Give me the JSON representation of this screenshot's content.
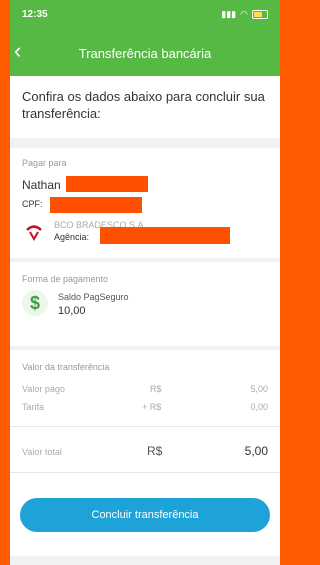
{
  "status_bar": {
    "time": "12:35",
    "icons": [
      "signal-icon",
      "wifi-icon",
      "battery-icon"
    ]
  },
  "header": {
    "title": "Transferência bancária"
  },
  "intro": {
    "text": "Confira os dados abaixo para concluir sua transferência:"
  },
  "payee": {
    "label": "Pagar para",
    "name": "Nathan",
    "cpf_label": "CPF:",
    "bank_name": "BCO BRADESCO S.A.",
    "agency_label": "Agência:"
  },
  "payment_method": {
    "label": "Forma de pagamento",
    "source": "Saldo PagSeguro",
    "amount": "10,00"
  },
  "summary": {
    "section_label": "Valor da transferência",
    "rows": [
      {
        "label": "Valor pago",
        "currency": "R$",
        "value": "5,00"
      },
      {
        "label": "Tarifa",
        "currency": "+ R$",
        "value": "0,00"
      }
    ],
    "total": {
      "label": "Valor total",
      "currency": "R$",
      "value": "5,00"
    }
  },
  "actions": {
    "confirm_label": "Concluir transferência"
  },
  "colors": {
    "header": "#55b944",
    "button": "#1ea3d8",
    "redaction": "#ff5000"
  }
}
